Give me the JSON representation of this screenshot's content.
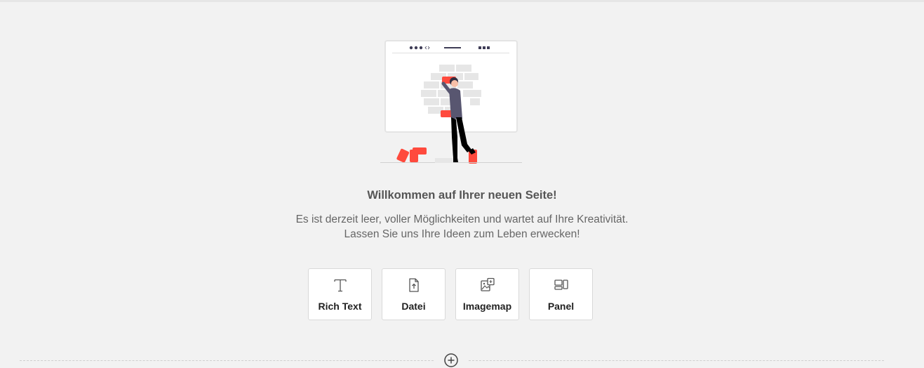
{
  "empty_state": {
    "title": "Willkommen auf Ihrer neuen Seite!",
    "description_line1": "Es ist derzeit leer, voller Möglichkeiten und wartet auf Ihre Kreativität.",
    "description_line2": "Lassen Sie uns Ihre Ideen zum Leben erwecken!"
  },
  "components": [
    {
      "label": "Rich Text",
      "icon": "text-t-icon"
    },
    {
      "label": "Datei",
      "icon": "file-upload-icon"
    },
    {
      "label": "Imagemap",
      "icon": "imagemap-icon"
    },
    {
      "label": "Panel",
      "icon": "panel-icon"
    }
  ],
  "colors": {
    "accent": "#ff4a3d",
    "background": "#f2f2f2",
    "card_border": "#d9d9d9",
    "figure_shirt": "#585670"
  }
}
